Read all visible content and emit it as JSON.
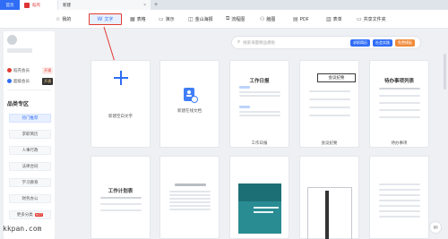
{
  "titlebar": {
    "home_tab": "首页",
    "wps_tab": "稻壳",
    "new_tab": "新建",
    "new_tab_close": "×",
    "add_tab": "+"
  },
  "toolbar": {
    "items": [
      {
        "label": "我的",
        "icon": "star-icon",
        "glyph": "☆"
      },
      {
        "label": "文字",
        "icon": "w-doc-icon",
        "glyph": "W",
        "active": true
      },
      {
        "label": "表格",
        "icon": "grid-icon",
        "glyph": "▦"
      },
      {
        "label": "演示",
        "icon": "presentation-icon",
        "glyph": "▭"
      },
      {
        "label": "金山海报",
        "icon": "poster-icon",
        "glyph": "◫"
      },
      {
        "label": "流程图",
        "icon": "flowchart-icon",
        "glyph": "⧉"
      },
      {
        "label": "脑图",
        "icon": "mindmap-icon",
        "glyph": "⚇"
      },
      {
        "label": "PDF",
        "icon": "pdf-icon",
        "glyph": "▤"
      },
      {
        "label": "表单",
        "icon": "form-icon",
        "glyph": "▥"
      },
      {
        "label": "共享文件夹",
        "icon": "folder-icon",
        "glyph": "▭"
      }
    ]
  },
  "left_panel": {
    "members": [
      {
        "label": "稻壳会员",
        "action": "开通",
        "color": "#e23b32"
      },
      {
        "label": "超级会员",
        "action": "开通",
        "color": "#2f6df6"
      }
    ],
    "section_title": "品类专区",
    "items": [
      {
        "label": "热门推荐",
        "selected": true
      },
      {
        "label": "求职简历"
      },
      {
        "label": "人事行政"
      },
      {
        "label": "法律合同"
      },
      {
        "label": "学习教育"
      },
      {
        "label": "财务办公"
      },
      {
        "label": "更多分类",
        "hot": "HOT"
      }
    ]
  },
  "search": {
    "placeholder": "搜索海量精品模板",
    "chips": [
      "求职简历",
      "社会实践",
      "免费模板"
    ]
  },
  "cards": {
    "blank": "新建空白文字",
    "online": "新建在线文档",
    "work_log": "工作日报",
    "meeting": "会议纪要",
    "todo": "待办事项"
  },
  "templates": {
    "work_log_title": "工作日报",
    "meeting_title": "会议纪要",
    "todo_title": "待办事项列表",
    "plan_title": "工作计划表",
    "meeting_rows": [
      "会议时间",
      "会议主题",
      "会议内容"
    ]
  },
  "watermark": "kkpan.com"
}
